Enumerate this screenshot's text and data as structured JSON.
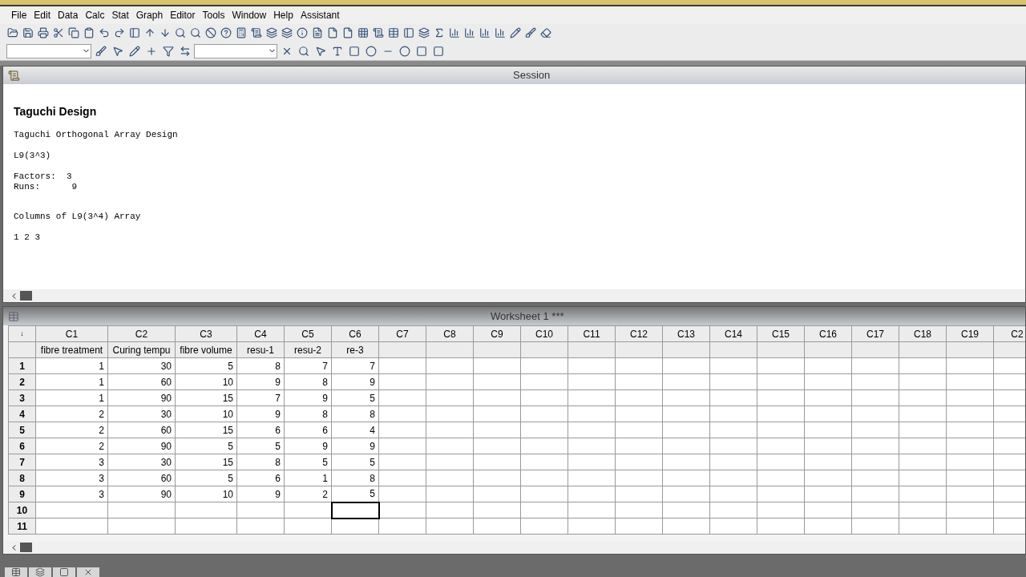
{
  "menu": [
    "File",
    "Edit",
    "Data",
    "Calc",
    "Stat",
    "Graph",
    "Editor",
    "Tools",
    "Window",
    "Help",
    "Assistant"
  ],
  "session": {
    "title": "Session",
    "heading": "Taguchi Design",
    "blocks": [
      [
        "Taguchi Orthogonal Array Design"
      ],
      [
        "L9(3^3)"
      ],
      [
        "Factors:  3",
        "Runs:      9"
      ],
      [
        "Columns of L9(3^4) Array"
      ],
      [
        "1 2 3"
      ]
    ]
  },
  "worksheet": {
    "title": "Worksheet 1 ***",
    "corner": "↓",
    "columns": [
      {
        "label": "C1",
        "name": "fibre treatment"
      },
      {
        "label": "C2",
        "name": "Curing tempu"
      },
      {
        "label": "C3",
        "name": "fibre volume"
      },
      {
        "label": "C4",
        "name": "resu-1"
      },
      {
        "label": "C5",
        "name": "resu-2"
      },
      {
        "label": "C6",
        "name": "re-3"
      },
      {
        "label": "C7"
      },
      {
        "label": "C8"
      },
      {
        "label": "C9"
      },
      {
        "label": "C10"
      },
      {
        "label": "C11"
      },
      {
        "label": "C12"
      },
      {
        "label": "C13"
      },
      {
        "label": "C14"
      },
      {
        "label": "C15"
      },
      {
        "label": "C16"
      },
      {
        "label": "C17"
      },
      {
        "label": "C18"
      },
      {
        "label": "C19"
      },
      {
        "label": "C2"
      }
    ],
    "rows": [
      {
        "label": "1",
        "cells": [
          "1",
          "30",
          "5",
          "8",
          "7",
          "7"
        ]
      },
      {
        "label": "2",
        "cells": [
          "1",
          "60",
          "10",
          "9",
          "8",
          "9"
        ]
      },
      {
        "label": "3",
        "cells": [
          "1",
          "90",
          "15",
          "7",
          "9",
          "5"
        ]
      },
      {
        "label": "4",
        "cells": [
          "2",
          "30",
          "10",
          "9",
          "8",
          "8"
        ]
      },
      {
        "label": "5",
        "cells": [
          "2",
          "60",
          "15",
          "6",
          "6",
          "4"
        ]
      },
      {
        "label": "6",
        "cells": [
          "2",
          "90",
          "5",
          "5",
          "9",
          "9"
        ]
      },
      {
        "label": "7",
        "cells": [
          "3",
          "30",
          "15",
          "8",
          "5",
          "5"
        ]
      },
      {
        "label": "8",
        "cells": [
          "3",
          "60",
          "5",
          "6",
          "1",
          "8"
        ]
      },
      {
        "label": "9",
        "cells": [
          "3",
          "90",
          "10",
          "9",
          "2",
          "5"
        ]
      },
      {
        "label": "10",
        "cells": [
          {
            "selected": false
          },
          {
            "selected": false
          },
          {
            "selected": false
          },
          {
            "selected": false
          },
          {
            "selected": false
          },
          {
            "selected": true
          }
        ]
      },
      {
        "label": "11",
        "cells": [
          {
            "selected": false
          },
          {
            "selected": false
          },
          {
            "selected": false
          },
          {
            "selected": false
          },
          {
            "selected": false
          },
          {
            "selected": false
          }
        ]
      }
    ]
  }
}
